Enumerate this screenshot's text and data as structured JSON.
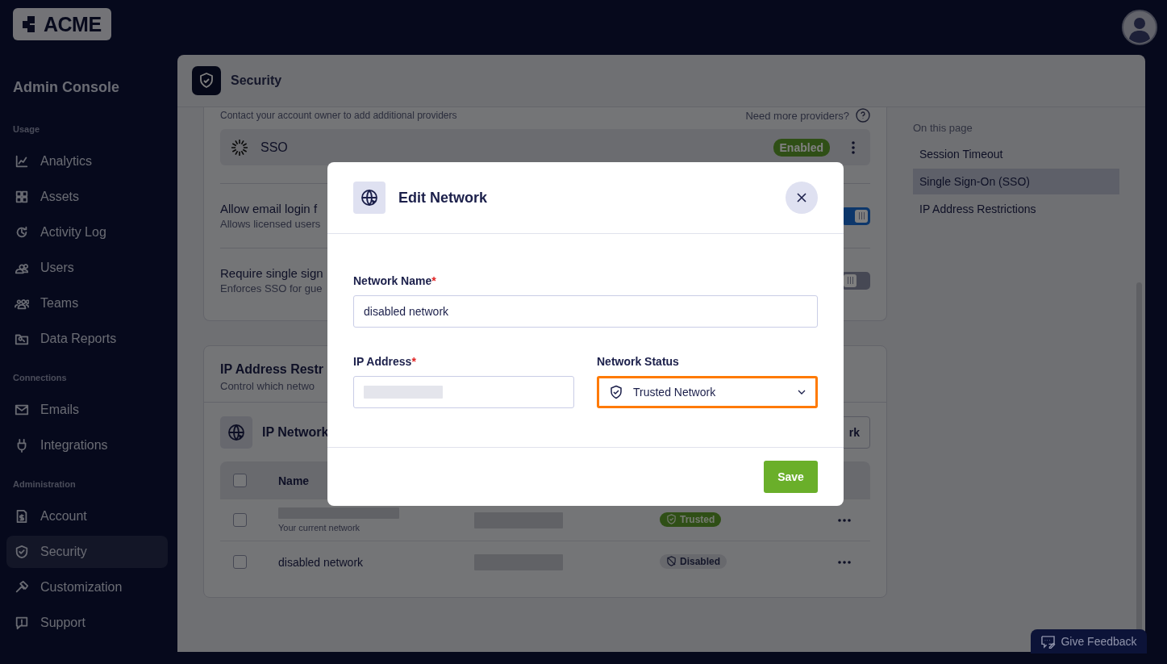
{
  "header": {
    "logo": "ACME"
  },
  "sidebar": {
    "title": "Admin Console",
    "sections": [
      {
        "heading": "Usage",
        "items": [
          {
            "label": "Analytics",
            "selected": false
          },
          {
            "label": "Assets",
            "selected": false
          },
          {
            "label": "Activity Log",
            "selected": false
          },
          {
            "label": "Users",
            "selected": false
          },
          {
            "label": "Teams",
            "selected": false
          },
          {
            "label": "Data Reports",
            "selected": false
          }
        ]
      },
      {
        "heading": "Connections",
        "items": [
          {
            "label": "Emails",
            "selected": false
          },
          {
            "label": "Integrations",
            "selected": false
          }
        ]
      },
      {
        "heading": "Administration",
        "items": [
          {
            "label": "Account",
            "selected": false
          },
          {
            "label": "Security",
            "selected": true
          },
          {
            "label": "Customization",
            "selected": false
          },
          {
            "label": "Support",
            "selected": false
          }
        ]
      }
    ]
  },
  "page": {
    "title": "Security"
  },
  "sso_card": {
    "note": "Contact your account owner to add additional providers",
    "help_link": "Need more providers?",
    "provider": {
      "name": "SSO",
      "status": "Enabled"
    },
    "settings": [
      {
        "title": "Allow email login f",
        "description": "Allows licensed users",
        "on": true
      },
      {
        "title": "Require single sign",
        "description": "Enforces SSO for gue",
        "on": false
      }
    ]
  },
  "ip_card": {
    "title": "IP Address Restr",
    "description": "Control which netwo",
    "section_title": "IP Network",
    "button": "rk",
    "table": {
      "header_checked": false,
      "columns": [
        "Name"
      ],
      "rows": [
        {
          "checked": false,
          "note": "Your current network",
          "status": {
            "label": "Trusted",
            "kind": "trusted"
          }
        },
        {
          "checked": false,
          "name": "disabled network",
          "status": {
            "label": "Disabled",
            "kind": "disabled"
          }
        }
      ]
    }
  },
  "on_this_page": {
    "heading": "On this page",
    "items": [
      {
        "label": "Session Timeout",
        "selected": false
      },
      {
        "label": "Single Sign-On (SSO)",
        "selected": true
      },
      {
        "label": "IP Address Restrictions",
        "selected": false
      }
    ]
  },
  "modal": {
    "title": "Edit Network",
    "fields": [
      {
        "kind": "text",
        "label": "Network Name",
        "required_mark": "*",
        "value": "disabled network",
        "wide": true
      },
      {
        "kind": "text",
        "label": "IP Address",
        "required_mark": "*",
        "wide": false
      },
      {
        "kind": "select",
        "label": "Network Status",
        "value": "Trusted Network",
        "focused": true,
        "wide": false
      }
    ],
    "save": "Save"
  },
  "feedback": {
    "label": "Give Feedback"
  }
}
